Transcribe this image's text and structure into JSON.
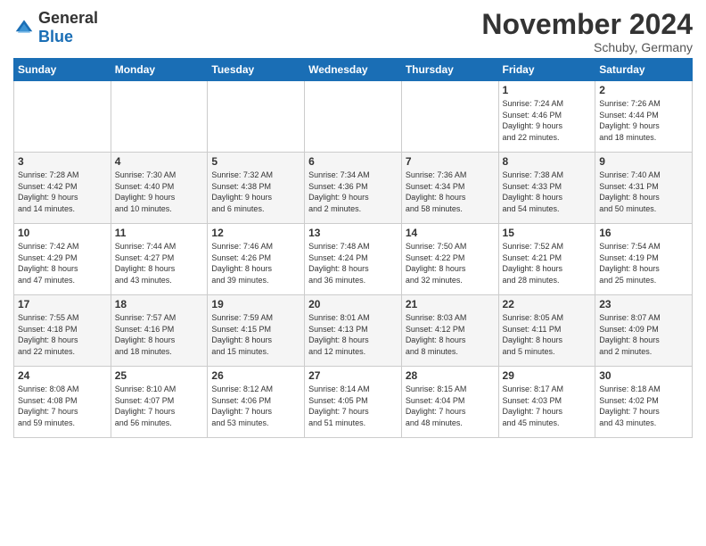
{
  "logo": {
    "general": "General",
    "blue": "Blue"
  },
  "title": "November 2024",
  "location": "Schuby, Germany",
  "days_header": [
    "Sunday",
    "Monday",
    "Tuesday",
    "Wednesday",
    "Thursday",
    "Friday",
    "Saturday"
  ],
  "weeks": [
    [
      {
        "day": "",
        "info": ""
      },
      {
        "day": "",
        "info": ""
      },
      {
        "day": "",
        "info": ""
      },
      {
        "day": "",
        "info": ""
      },
      {
        "day": "",
        "info": ""
      },
      {
        "day": "1",
        "info": "Sunrise: 7:24 AM\nSunset: 4:46 PM\nDaylight: 9 hours\nand 22 minutes."
      },
      {
        "day": "2",
        "info": "Sunrise: 7:26 AM\nSunset: 4:44 PM\nDaylight: 9 hours\nand 18 minutes."
      }
    ],
    [
      {
        "day": "3",
        "info": "Sunrise: 7:28 AM\nSunset: 4:42 PM\nDaylight: 9 hours\nand 14 minutes."
      },
      {
        "day": "4",
        "info": "Sunrise: 7:30 AM\nSunset: 4:40 PM\nDaylight: 9 hours\nand 10 minutes."
      },
      {
        "day": "5",
        "info": "Sunrise: 7:32 AM\nSunset: 4:38 PM\nDaylight: 9 hours\nand 6 minutes."
      },
      {
        "day": "6",
        "info": "Sunrise: 7:34 AM\nSunset: 4:36 PM\nDaylight: 9 hours\nand 2 minutes."
      },
      {
        "day": "7",
        "info": "Sunrise: 7:36 AM\nSunset: 4:34 PM\nDaylight: 8 hours\nand 58 minutes."
      },
      {
        "day": "8",
        "info": "Sunrise: 7:38 AM\nSunset: 4:33 PM\nDaylight: 8 hours\nand 54 minutes."
      },
      {
        "day": "9",
        "info": "Sunrise: 7:40 AM\nSunset: 4:31 PM\nDaylight: 8 hours\nand 50 minutes."
      }
    ],
    [
      {
        "day": "10",
        "info": "Sunrise: 7:42 AM\nSunset: 4:29 PM\nDaylight: 8 hours\nand 47 minutes."
      },
      {
        "day": "11",
        "info": "Sunrise: 7:44 AM\nSunset: 4:27 PM\nDaylight: 8 hours\nand 43 minutes."
      },
      {
        "day": "12",
        "info": "Sunrise: 7:46 AM\nSunset: 4:26 PM\nDaylight: 8 hours\nand 39 minutes."
      },
      {
        "day": "13",
        "info": "Sunrise: 7:48 AM\nSunset: 4:24 PM\nDaylight: 8 hours\nand 36 minutes."
      },
      {
        "day": "14",
        "info": "Sunrise: 7:50 AM\nSunset: 4:22 PM\nDaylight: 8 hours\nand 32 minutes."
      },
      {
        "day": "15",
        "info": "Sunrise: 7:52 AM\nSunset: 4:21 PM\nDaylight: 8 hours\nand 28 minutes."
      },
      {
        "day": "16",
        "info": "Sunrise: 7:54 AM\nSunset: 4:19 PM\nDaylight: 8 hours\nand 25 minutes."
      }
    ],
    [
      {
        "day": "17",
        "info": "Sunrise: 7:55 AM\nSunset: 4:18 PM\nDaylight: 8 hours\nand 22 minutes."
      },
      {
        "day": "18",
        "info": "Sunrise: 7:57 AM\nSunset: 4:16 PM\nDaylight: 8 hours\nand 18 minutes."
      },
      {
        "day": "19",
        "info": "Sunrise: 7:59 AM\nSunset: 4:15 PM\nDaylight: 8 hours\nand 15 minutes."
      },
      {
        "day": "20",
        "info": "Sunrise: 8:01 AM\nSunset: 4:13 PM\nDaylight: 8 hours\nand 12 minutes."
      },
      {
        "day": "21",
        "info": "Sunrise: 8:03 AM\nSunset: 4:12 PM\nDaylight: 8 hours\nand 8 minutes."
      },
      {
        "day": "22",
        "info": "Sunrise: 8:05 AM\nSunset: 4:11 PM\nDaylight: 8 hours\nand 5 minutes."
      },
      {
        "day": "23",
        "info": "Sunrise: 8:07 AM\nSunset: 4:09 PM\nDaylight: 8 hours\nand 2 minutes."
      }
    ],
    [
      {
        "day": "24",
        "info": "Sunrise: 8:08 AM\nSunset: 4:08 PM\nDaylight: 7 hours\nand 59 minutes."
      },
      {
        "day": "25",
        "info": "Sunrise: 8:10 AM\nSunset: 4:07 PM\nDaylight: 7 hours\nand 56 minutes."
      },
      {
        "day": "26",
        "info": "Sunrise: 8:12 AM\nSunset: 4:06 PM\nDaylight: 7 hours\nand 53 minutes."
      },
      {
        "day": "27",
        "info": "Sunrise: 8:14 AM\nSunset: 4:05 PM\nDaylight: 7 hours\nand 51 minutes."
      },
      {
        "day": "28",
        "info": "Sunrise: 8:15 AM\nSunset: 4:04 PM\nDaylight: 7 hours\nand 48 minutes."
      },
      {
        "day": "29",
        "info": "Sunrise: 8:17 AM\nSunset: 4:03 PM\nDaylight: 7 hours\nand 45 minutes."
      },
      {
        "day": "30",
        "info": "Sunrise: 8:18 AM\nSunset: 4:02 PM\nDaylight: 7 hours\nand 43 minutes."
      }
    ]
  ]
}
